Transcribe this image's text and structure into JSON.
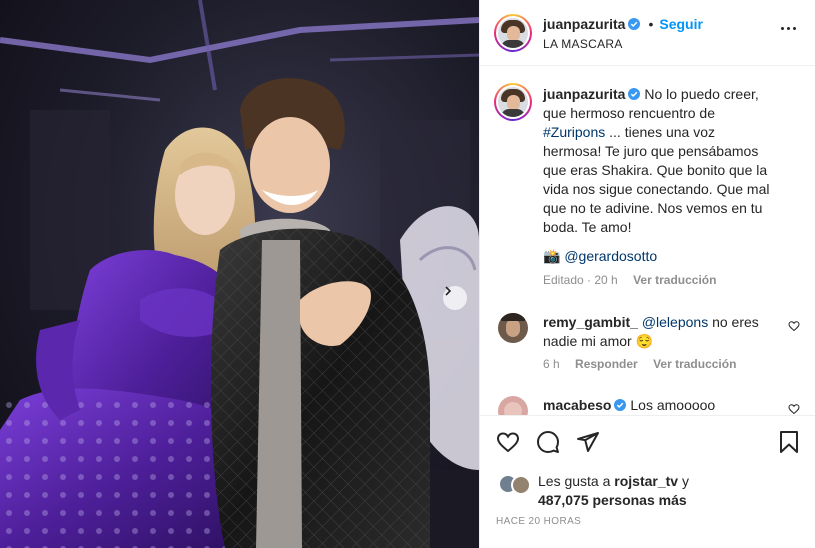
{
  "post": {
    "username": "juanpazurita",
    "follow_label": "Seguir",
    "separator": "•",
    "location": "LA MASCARA"
  },
  "caption": {
    "username": "juanpazurita",
    "text_before_tag": "No lo puedo creer, que hermoso rencuentro de",
    "hashtag": "#Zuripons",
    "text_after_tag": "... tienes una voz hermosa! Te juro que pensábamos que eras Shakira. Que bonito que la vida nos sigue conectando. Que mal que no te adivine. Nos vemos en tu boda. Te amo!",
    "camera_emoji": "📸",
    "photo_credit": "@gerardosotto",
    "edited_label": "Editado",
    "time": "20 h",
    "translate_label": "Ver traducción"
  },
  "comments": [
    {
      "username": "remy_gambit_",
      "mention": "@lelepons",
      "text": "no eres nadie mi amor",
      "emoji": "😌",
      "time": "6 h",
      "reply_label": "Responder",
      "translate_label": "Ver traducción"
    },
    {
      "username": "macabeso",
      "text": "Los amooooo"
    }
  ],
  "likes": {
    "prefix": "Les gusta a",
    "user": "rojstar_tv",
    "conjunction": "y",
    "count": "487,075 personas más"
  },
  "timestamp": "HACE 20 HORAS",
  "colors": {
    "link_blue": "#0095f6",
    "mention_blue": "#00376b",
    "verified_blue": "#3897f0",
    "muted": "#8e8e8e"
  }
}
